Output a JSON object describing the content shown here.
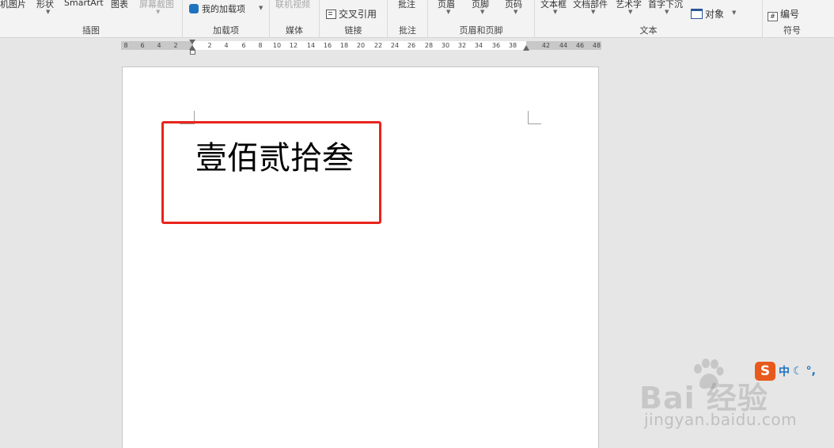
{
  "ribbon": {
    "groups": {
      "illustrations": {
        "label": "插图",
        "items": [
          "机图片",
          "形状",
          "SmartArt",
          "图表",
          "屏幕截图"
        ]
      },
      "addins": {
        "label": "加载项",
        "my_addins": "我的加载项"
      },
      "media": {
        "label": "媒体",
        "online_video": "联机视频"
      },
      "links": {
        "label": "链接",
        "cross_reference": "交叉引用"
      },
      "comments": {
        "label": "批注",
        "comment": "批注"
      },
      "header_footer": {
        "label": "页眉和页脚",
        "header": "页眉",
        "footer": "页脚",
        "page_number": "页码"
      },
      "text": {
        "label": "文本",
        "text_box": "文本框",
        "quick_parts": "文档部件",
        "wordart": "艺术字",
        "drop_cap": "首字下沉",
        "object": "对象"
      },
      "symbols": {
        "label": "符号",
        "numbering": "编号"
      }
    }
  },
  "ruler": {
    "ticks": [
      "8",
      "6",
      "4",
      "2",
      "2",
      "4",
      "6",
      "8",
      "10",
      "12",
      "14",
      "16",
      "18",
      "20",
      "22",
      "24",
      "26",
      "28",
      "30",
      "32",
      "34",
      "36",
      "38",
      "42",
      "44",
      "46",
      "48"
    ]
  },
  "document": {
    "text": "壹佰贰拾叁"
  },
  "annotation": {
    "color": "#e8241c"
  },
  "watermark": {
    "brand": "Bai  经验",
    "url": "jingyan.baidu.com"
  },
  "ime": {
    "logo": "S",
    "mode": "中",
    "punct": "°,"
  },
  "colors": {
    "accent": "#2b579a",
    "ime_orange": "#e85a1c",
    "ime_blue": "#1e73be"
  }
}
